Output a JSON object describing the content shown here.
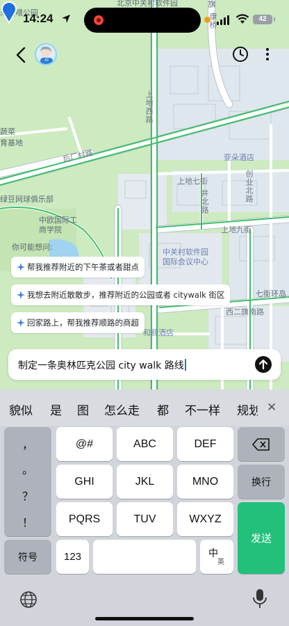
{
  "status_bar": {
    "time": "14:24",
    "battery": "42"
  },
  "map": {
    "labels": {
      "golf": "米夏喂公园",
      "top_center": "北京中关村软件园",
      "qi_xian": "旗",
      "shang_di_xi_lu": "上地西路",
      "kang_bei": "康桥",
      "yuan_cai": "蔬菜",
      "jidi": "育基地",
      "hou_chang_cun": "后厂村路",
      "ya_duo": "亚朵酒店",
      "shang_di_qi": "上地七街",
      "green_tennis": "绿豆网球俱乐部",
      "jingkai": "井北路",
      "chuangye": "创业北路",
      "ceibs": "中欧国际工商学院",
      "shang_di_jiu": "上地九街",
      "zgc_park": "中关村软件园国际会议中心",
      "yihe_hotel": "和颐酒店",
      "qijie": "七街环岛",
      "xi_er_qi": "西二旗南路",
      "xi_er_qi_2": "西二旗南路"
    }
  },
  "suggestions": {
    "title": "你可能想问:",
    "items": [
      "帮我推荐附近的下午茶或者甜点",
      "我想去附近散散步，推荐附近的公园或者 citywalk 街区",
      "回家路上，帮我推荐顺路的商超"
    ]
  },
  "input": {
    "value": "制定一条奥林匹克公园 city walk 路线"
  },
  "keyboard": {
    "candidates": [
      "貌似",
      "是",
      "图",
      "怎么走",
      "都",
      "不一样",
      "规划"
    ],
    "punct": [
      "，",
      "。",
      "？",
      "！"
    ],
    "keys_row1": [
      "@#",
      "ABC",
      "DEF"
    ],
    "keys_row2": [
      "GHI",
      "JKL",
      "MNO"
    ],
    "keys_row3": [
      "PQRS",
      "TUV",
      "WXYZ"
    ],
    "symbol_key": "符号",
    "num_key": "123",
    "lang_main": "中",
    "lang_sub": "英",
    "newline_key": "换行",
    "send_key": "发送"
  },
  "avatar_badge": "AI",
  "colors": {
    "map_green": "#cfe8c3",
    "send_green": "#22c07a",
    "pin_blue": "#1e6fe0"
  }
}
